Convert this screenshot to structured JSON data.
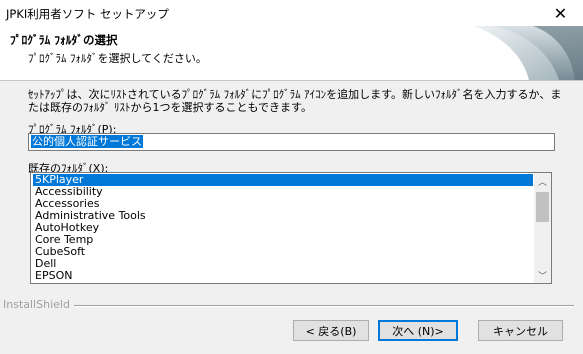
{
  "window": {
    "title": "JPKI利用者ソフト セットアップ"
  },
  "header": {
    "title": "ﾌﾟﾛｸﾞﾗﾑ ﾌｫﾙﾀﾞの選択",
    "subtitle": "ﾌﾟﾛｸﾞﾗﾑ ﾌｫﾙﾀﾞを選択してください。"
  },
  "description": "ｾｯﾄｱｯﾌﾟは、次にﾘｽﾄされているﾌﾟﾛｸﾞﾗﾑ ﾌｫﾙﾀﾞにﾌﾟﾛｸﾞﾗﾑ ｱｲｺﾝを追加します。新しいﾌｫﾙﾀﾞ名を入力するか、または既存のﾌｫﾙﾀﾞ ﾘｽﾄから1つを選択することもできます。",
  "folder_field": {
    "label": "ﾌﾟﾛｸﾞﾗﾑ ﾌｫﾙﾀﾞ(P):",
    "value": "公的個人認証サービス"
  },
  "existing_folders": {
    "label": "既存のﾌｫﾙﾀﾞ(X):",
    "items": [
      "5KPlayer",
      "Accessibility",
      "Accessories",
      "Administrative Tools",
      "AutoHotkey",
      "Core Temp",
      "CubeSoft",
      "Dell",
      "EPSON"
    ],
    "selected_index": 0
  },
  "footer": {
    "brand": "InstallShield"
  },
  "buttons": {
    "back": "< 戻る(B)",
    "next": "次へ (N)>",
    "cancel": "キャンセル"
  },
  "colors": {
    "selection": "#0078d7",
    "default_button_border": "#0078d7"
  }
}
